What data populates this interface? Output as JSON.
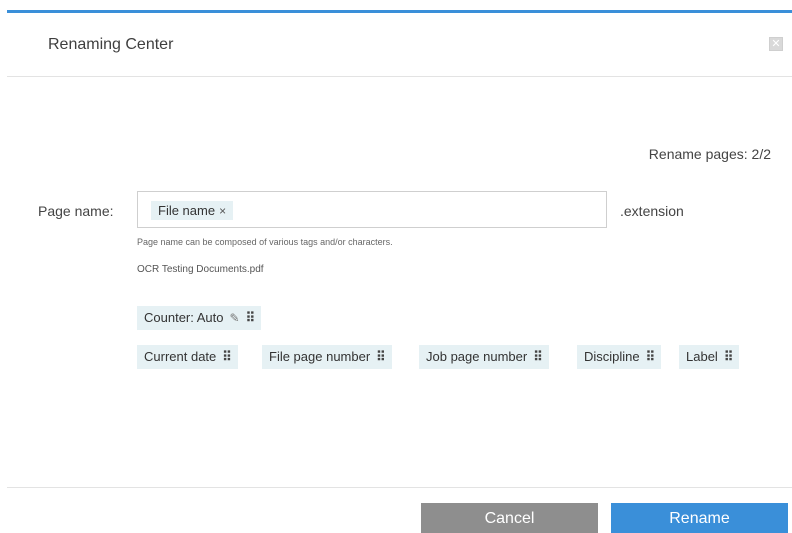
{
  "dialog": {
    "title": "Renaming Center",
    "close_icon": "close-icon",
    "accent_color": "#3a8fd9"
  },
  "rename_pages": "Rename pages: 2/2",
  "page_name": {
    "label": "Page name:",
    "tags": [
      {
        "label": "File name",
        "remove_glyph": "×"
      }
    ],
    "extension": ".extension",
    "hint": "Page name can be composed of various tags and/or characters.",
    "file_name": "OCR Testing Documents.pdf"
  },
  "available_tags": {
    "counter": {
      "label": "Counter: Auto",
      "edit_icon": "pencil-icon",
      "grip_icon": "drag-handle-icon"
    },
    "row": [
      {
        "label": "Current date"
      },
      {
        "label": "File page number"
      },
      {
        "label": "Job page number"
      },
      {
        "label": "Discipline"
      },
      {
        "label": "Label"
      }
    ]
  },
  "footer": {
    "cancel_label": "Cancel",
    "rename_label": "Rename"
  }
}
